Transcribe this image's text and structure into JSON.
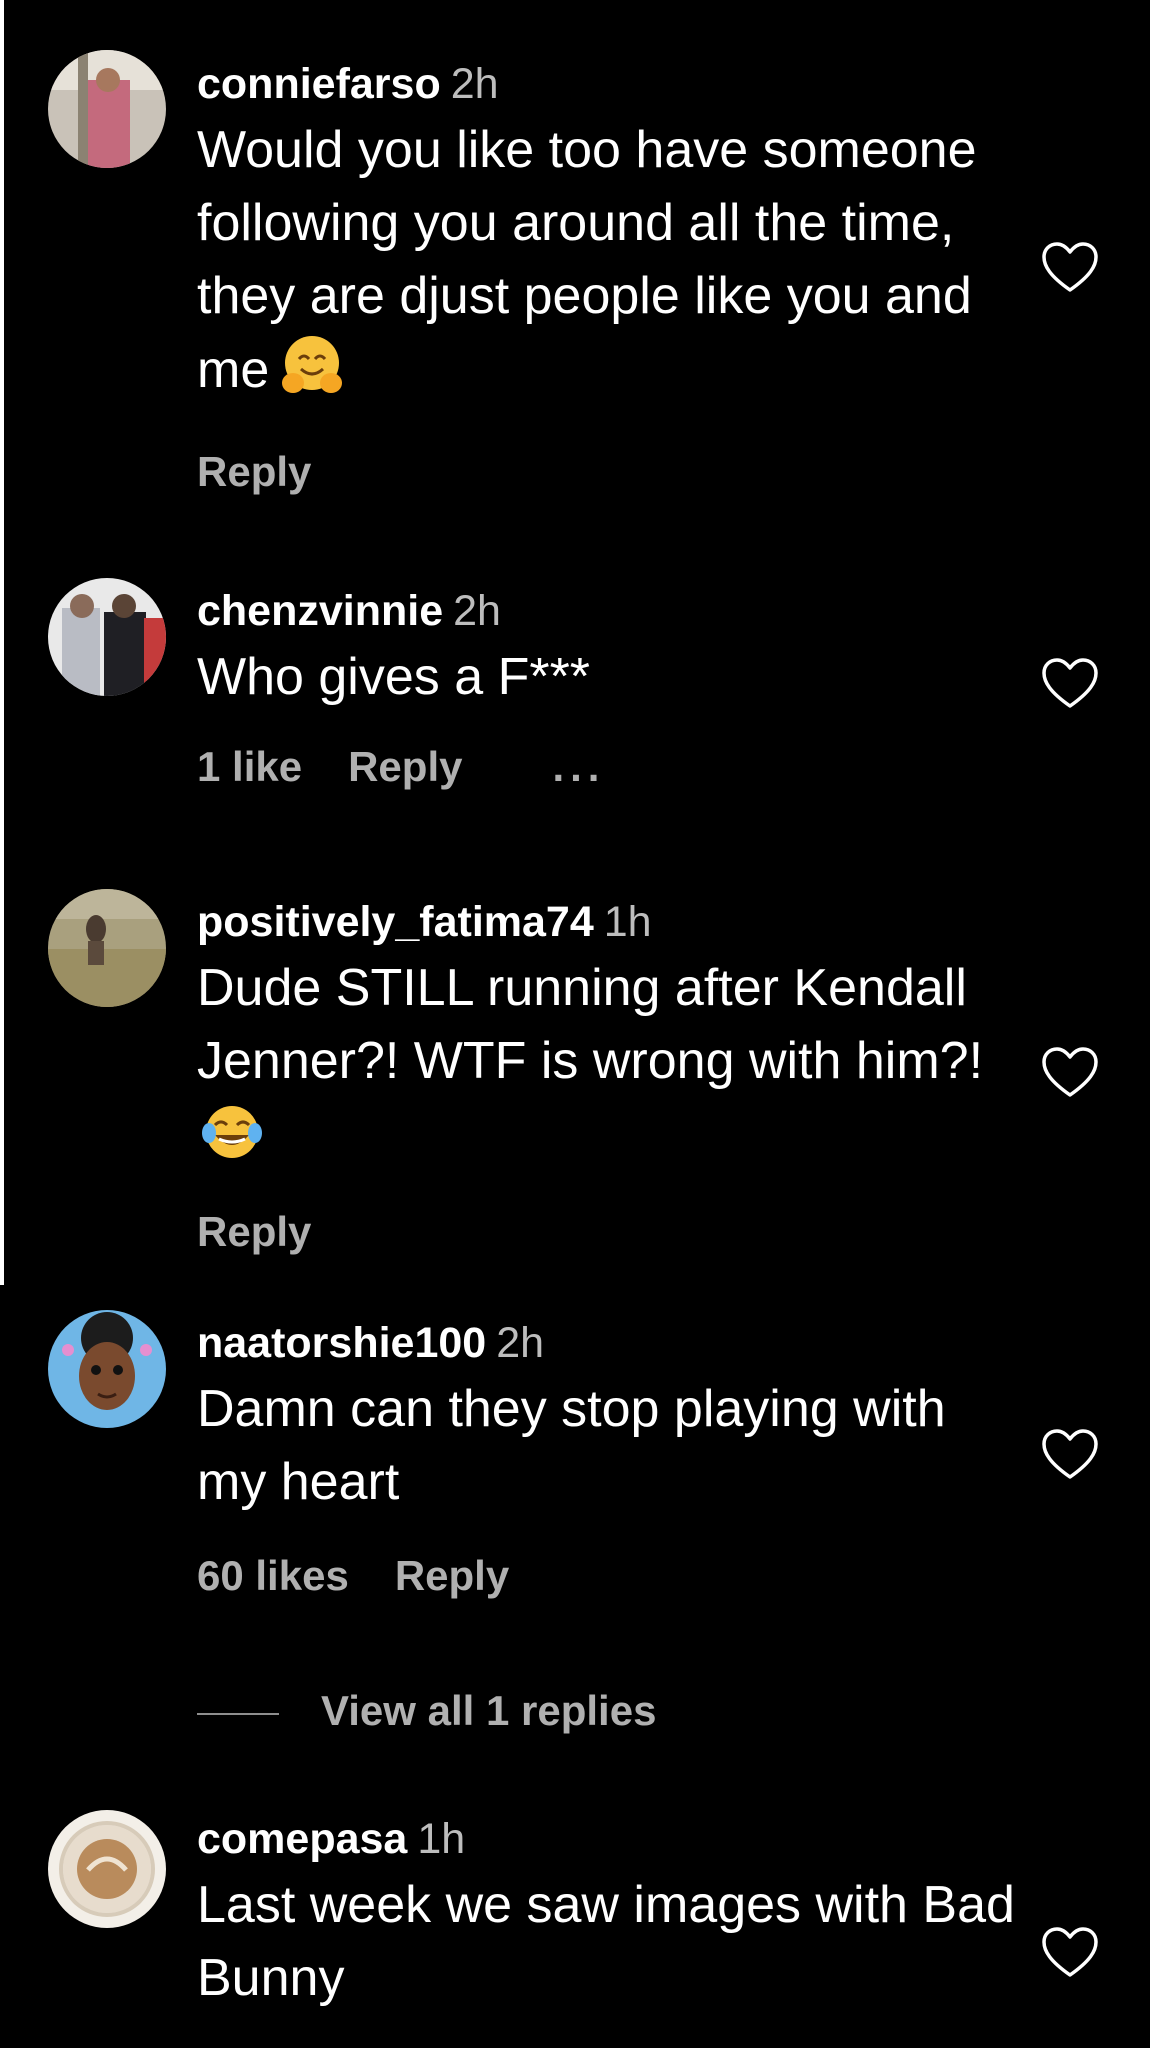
{
  "comments": [
    {
      "username": "conniefarso",
      "time": "2h",
      "text": "Would you like too have someone following you around all the time, they are djust people like you and me",
      "emoji": "hugging-face-emoji",
      "likes": "",
      "reply_label": "Reply"
    },
    {
      "username": "chenzvinnie",
      "time": "2h",
      "text": "Who gives a F***",
      "likes": "1 like",
      "reply_label": "Reply",
      "more_label": "..."
    },
    {
      "username": "positively_fatima74",
      "time": "1h",
      "text": "Dude STILL running after Kendall Jenner?! WTF is wrong with him?!",
      "emoji": "tears-of-joy-emoji",
      "likes": "",
      "reply_label": "Reply"
    },
    {
      "username": "naatorshie100",
      "time": "2h",
      "text": "Damn can they stop playing with my heart",
      "likes": "60 likes",
      "reply_label": "Reply",
      "view_replies": "View all 1 replies"
    },
    {
      "username": "comepasa",
      "time": "1h",
      "text": "Last week we saw images with Bad Bunny"
    }
  ],
  "icons": {
    "like": "heart-outline-icon"
  },
  "colors": {
    "background": "#000000",
    "text": "#ffffff",
    "secondary_text": "#b0b0b0"
  }
}
